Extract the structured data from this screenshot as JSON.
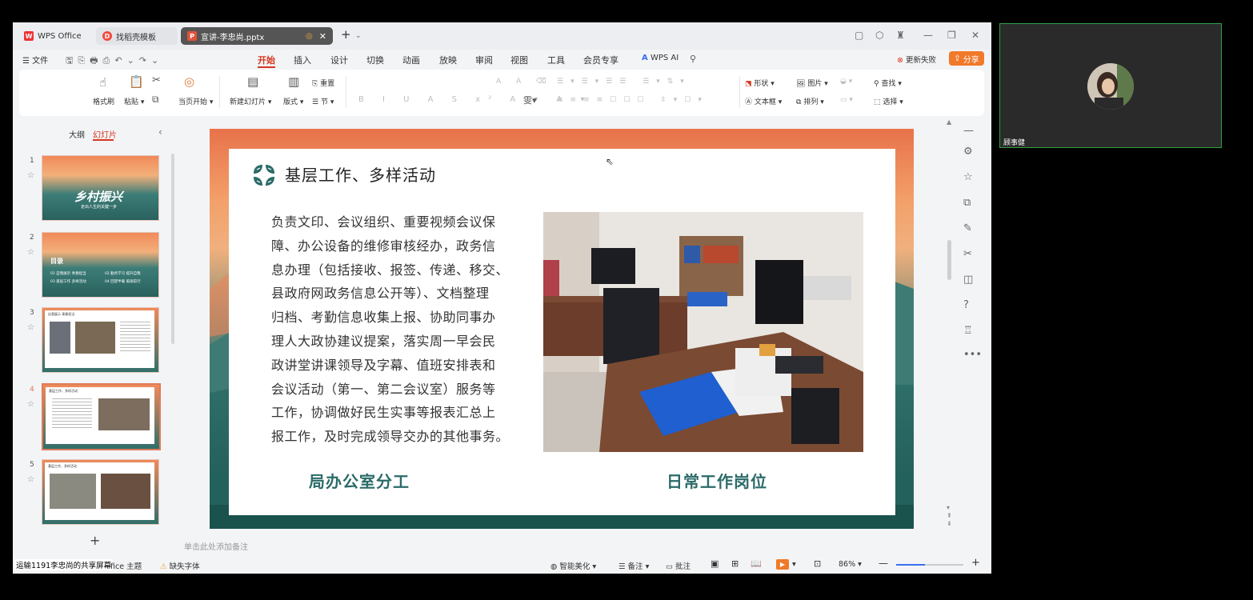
{
  "window": {
    "tabs": [
      {
        "label": "WPS Office",
        "badge": "W"
      },
      {
        "label": "找稻壳模板",
        "badge": "D"
      },
      {
        "label": "宣讲-李忠尚.pptx",
        "badge": "P"
      }
    ],
    "new_tab": "+",
    "controls": [
      "▢",
      "⬡",
      "♜",
      "—",
      "❐",
      "✕"
    ]
  },
  "menubar": {
    "file_label": "文件",
    "tabs": [
      "开始",
      "插入",
      "设计",
      "切换",
      "动画",
      "放映",
      "审阅",
      "视图",
      "工具",
      "会员专享"
    ],
    "active_tab": "开始",
    "ai_label": "WPS AI",
    "update_label": "更新失败",
    "share_label": "分享"
  },
  "ribbon": {
    "format_painter": "格式刷",
    "paste": "粘贴",
    "play_from_current": "当页开始",
    "new_slide": "新建幻灯片",
    "layout": "版式",
    "section": "节",
    "reset": "重置",
    "shape": "形状",
    "picture": "图片",
    "textbox": "文本框",
    "arrange": "排列",
    "find": "查找",
    "select": "选择"
  },
  "leftpane": {
    "outline_tab": "大纲",
    "slides_tab": "幻灯片",
    "add_label": "+",
    "slides": [
      {
        "num": "1",
        "title": "乡村振兴",
        "subtitle": "走出人生的关键一步"
      },
      {
        "num": "2",
        "title": "目录",
        "items": [
          "01 自我展示  青春担当",
          "02 勤务学习  提升自我",
          "03 基层工作  多样活动",
          "04 回望半载  砥砺前行"
        ]
      },
      {
        "num": "3",
        "title": "自我展示  青春担当"
      },
      {
        "num": "4",
        "title": "基层工作、多样活动"
      },
      {
        "num": "5",
        "title": "基层工作、多样活动"
      }
    ]
  },
  "slide": {
    "title": "基层工作、多样活动",
    "body_lines": [
      "负责文印、会议组织、重要视频会议保",
      "障、办公设备的维修审核经办，政务信",
      "息办理（包括接收、报签、传递、移交、",
      "县政府网政务信息公开等）、文档整理",
      "归档、考勤信息收集上报、协助同事办",
      "理人大政协建议提案，落实周一早会民",
      "政讲堂讲课领导及字幕、值班安排表和",
      "会议活动（第一、第二会议室）服务等",
      "工作，协调做好民生实事等报表汇总上",
      "报工作，及时完成领导交办的其他事务。"
    ],
    "caption_left": "局办公室分工",
    "caption_right": "日常工作岗位"
  },
  "notes_placeholder": "单击此处添加备注",
  "statusbar": {
    "share_notice": "运输1191李忠尚的共享屏幕",
    "theme": "fice 主题",
    "missing_font": "缺失字体",
    "smart_beautify": "智能美化",
    "notes": "备注",
    "comments": "批注",
    "zoom": "86%"
  },
  "video": {
    "participant_name": "顾事健"
  },
  "colors": {
    "accent": "#d6371f",
    "share": "#f07a2a",
    "slide_teal": "#2b6b68"
  }
}
